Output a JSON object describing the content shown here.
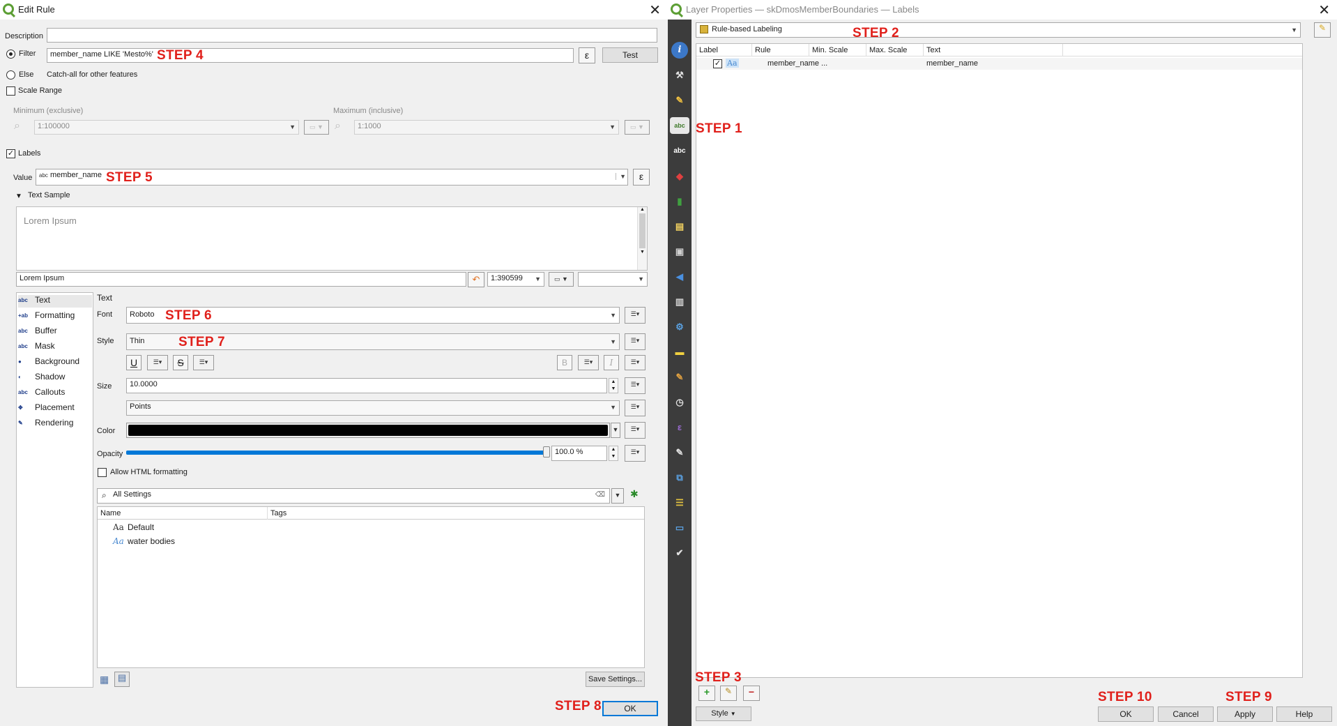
{
  "edit_rule": {
    "title": "Edit Rule",
    "description_label": "Description",
    "description_value": "",
    "filter_label": "Filter",
    "filter_value": "member_name LIKE 'Mesto%'",
    "test_label": "Test",
    "epsilon": "ε",
    "else_label": "Else",
    "else_desc": "Catch-all for other features",
    "scale_range_label": "Scale Range",
    "minimum_label": "Minimum (exclusive)",
    "maximum_label": "Maximum (inclusive)",
    "min_value": "1:100000",
    "max_value": "1:1000",
    "labels_label": "Labels",
    "value_label": "Value",
    "value_field": "member_name",
    "value_prefix": "abc",
    "text_sample_label": "Text Sample",
    "sample_text": "Lorem Ipsum",
    "sample_input": "Lorem Ipsum",
    "sample_scale": "1:390599",
    "sections": [
      {
        "icon": "abc",
        "label": "Text"
      },
      {
        "icon": "+ab",
        "label": "Formatting"
      },
      {
        "icon": "abc",
        "label": "Buffer"
      },
      {
        "icon": "abc",
        "label": "Mask"
      },
      {
        "icon": "●",
        "label": "Background"
      },
      {
        "icon": "◐",
        "label": "Shadow"
      },
      {
        "icon": "abc",
        "label": "Callouts"
      },
      {
        "icon": "✥",
        "label": "Placement"
      },
      {
        "icon": "✎",
        "label": "Rendering"
      }
    ],
    "text_heading": "Text",
    "font_label": "Font",
    "font_value": "Roboto",
    "style_label": "Style",
    "style_value": "Thin",
    "size_label": "Size",
    "size_value": "10.0000",
    "units_value": "Points",
    "color_label": "Color",
    "color_value": "#000000",
    "opacity_label": "Opacity",
    "opacity_value": "100.0 %",
    "opacity_fraction": 1.0,
    "html_label": "Allow HTML formatting",
    "search_value": "All Settings",
    "col_name": "Name",
    "col_tags": "Tags",
    "styles": [
      {
        "icon": "Aa",
        "name": "Default"
      },
      {
        "icon": "Aa",
        "name": "water bodies"
      }
    ],
    "save_settings": "Save Settings...",
    "ok": "OK"
  },
  "layer_props": {
    "title": "Layer Properties — skDmosMemberBoundaries — Labels",
    "mode": "Rule-based Labeling",
    "columns": [
      "Label",
      "Rule",
      "Min. Scale",
      "Max. Scale",
      "Text"
    ],
    "rows": [
      {
        "checked": true,
        "label": "Aa",
        "rule": "member_name ...",
        "min": "",
        "max": "",
        "text": "member_name"
      }
    ],
    "style_button": "Style",
    "ok": "OK",
    "cancel": "Cancel",
    "apply": "Apply",
    "help": "Help"
  },
  "steps": {
    "s1": "STEP 1",
    "s2": "STEP 2",
    "s3": "STEP 3",
    "s4": "STEP 4",
    "s5": "STEP 5",
    "s6": "STEP 6",
    "s7": "STEP 7",
    "s8": "STEP 8",
    "s9": "STEP 9",
    "s10": "STEP 10"
  },
  "colors": {
    "accent": "#0078d7",
    "step": "#e0201b",
    "sidebar": "#3c3c3c"
  }
}
